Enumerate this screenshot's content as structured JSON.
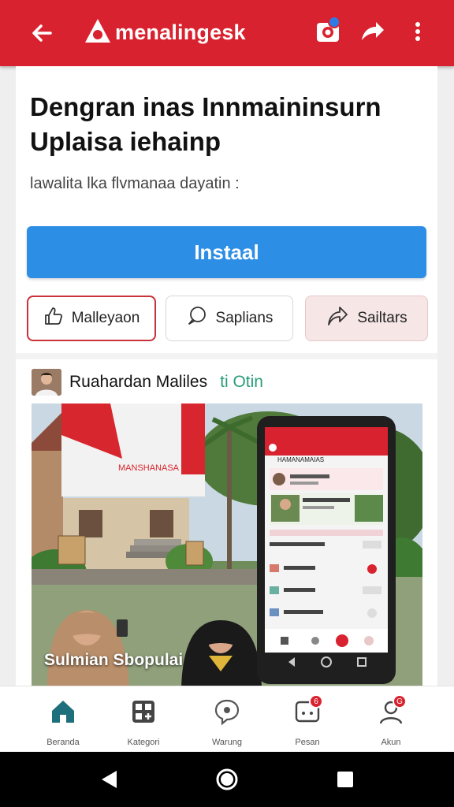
{
  "appbar": {
    "title": "menalingesk",
    "notification_count": "",
    "colors": {
      "bar": "#d9222f",
      "text": "#ffffff"
    },
    "icons": [
      "back-arrow-icon",
      "app-logo-icon",
      "camera-icon",
      "share-icon",
      "more-vert-icon"
    ]
  },
  "content": {
    "headline": "Dengran inas Innmaininsurn Uplaisa iehainp",
    "subtitle": "lawalita lka flvmanaa dayatin :",
    "install_label": "Instaal",
    "actions": [
      {
        "label": "Malleyaon",
        "icon": "thumbs-up-icon"
      },
      {
        "label": "Saplians",
        "icon": "comment-icon"
      },
      {
        "label": "Sailtars",
        "icon": "share-outline-icon"
      }
    ],
    "accent_blue": "#2d8ee6"
  },
  "post": {
    "author": "Ruahardan Maliles",
    "tag": "ti Otin",
    "caption": "Sulmian Sbopulai",
    "phone_screen_title": "HAMANAMAIAS"
  },
  "bottom_nav": {
    "items": [
      {
        "label": "Beranda",
        "icon": "home-icon",
        "badge": ""
      },
      {
        "label": "Kategori",
        "icon": "apps-icon",
        "badge": ""
      },
      {
        "label": "Warung",
        "icon": "chat-icon",
        "badge": ""
      },
      {
        "label": "Pesan",
        "icon": "inbox-icon",
        "badge": "6"
      },
      {
        "label": "Akun",
        "icon": "profile-icon",
        "badge": "G"
      }
    ]
  },
  "system_nav": {
    "icons": [
      "back-triangle-icon",
      "home-circle-icon",
      "recents-square-icon"
    ]
  }
}
